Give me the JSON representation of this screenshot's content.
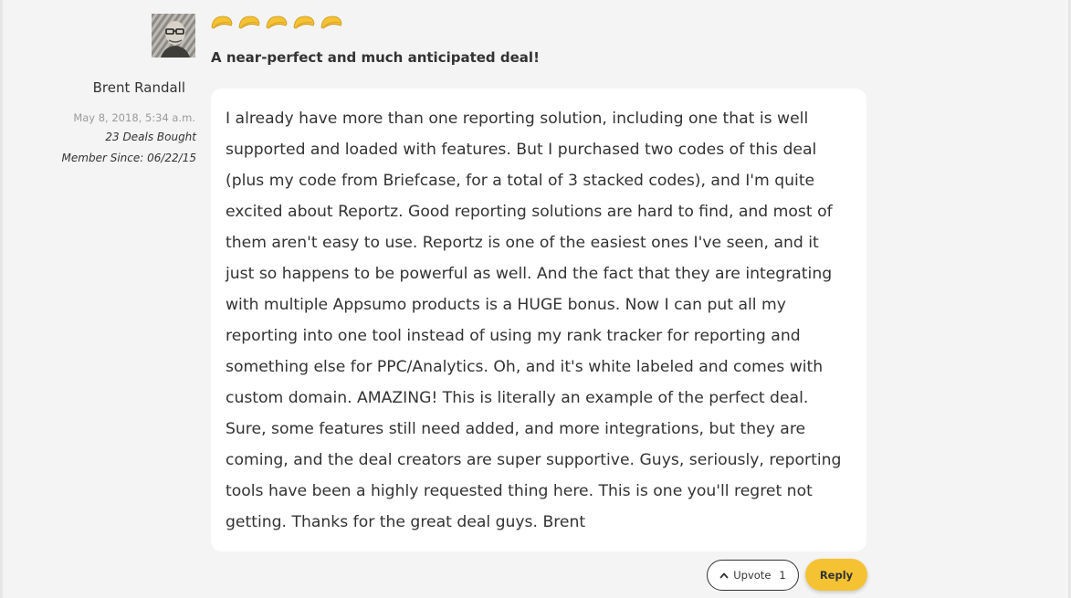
{
  "reviewer": {
    "name": "Brent Randall",
    "date": "May 8, 2018, 5:34 a.m.",
    "deals_bought": "23 Deals Bought",
    "member_since": "Member Since: 06/22/15",
    "avatar_icon": "user-avatar-photo"
  },
  "review": {
    "rating": 5,
    "rating_max": 5,
    "rating_icon": "taco-icon",
    "rating_color": "#f4c233",
    "title": "A near-perfect and much anticipated deal!",
    "body": "I already have more than one reporting solution, including one that is well supported and loaded with features. But I purchased two codes of this deal (plus my code from Briefcase, for a total of 3 stacked codes), and I'm quite excited about Reportz. Good reporting solutions are hard to find, and most of them aren't easy to use. Reportz is one of the easiest ones I've seen, and it just so happens to be powerful as well. And the fact that they are integrating with multiple Appsumo products is a HUGE bonus. Now I can put all my reporting into one tool instead of using my rank tracker for reporting and something else for PPC/Analytics. Oh, and it's white labeled and comes with custom domain. AMAZING! This is literally an example of the perfect deal. Sure, some features still need added, and more integrations, but they are coming, and the deal creators are super supportive. Guys, seriously, reporting tools have been a highly requested thing here. This is one you'll regret not getting. Thanks for the great deal guys. Brent"
  },
  "actions": {
    "upvote_label": "Upvote",
    "upvote_count": "1",
    "upvote_icon": "chevron-up-icon",
    "reply_label": "Reply",
    "reply_color": "#f4c233"
  }
}
